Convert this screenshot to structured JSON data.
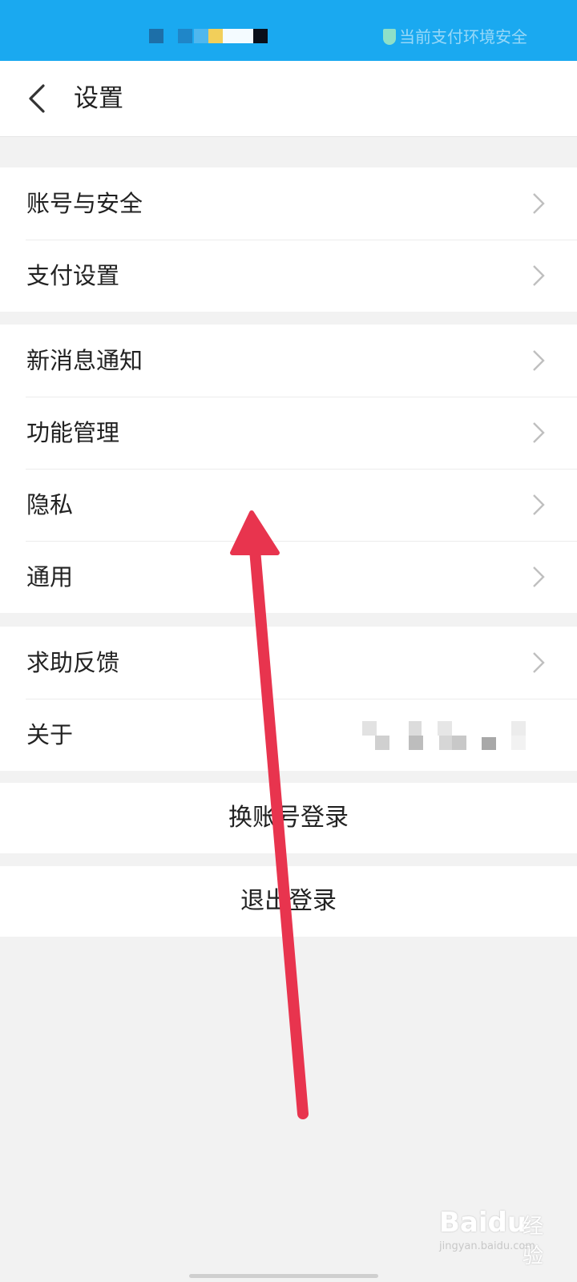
{
  "status_bar": {
    "color": "#1aa9f0",
    "pay_status_text": "当前支付环境安全"
  },
  "header": {
    "title": "设置",
    "back_icon": "chevron-left-icon"
  },
  "groups": [
    {
      "items": [
        {
          "label": "账号与安全"
        },
        {
          "label": "支付设置"
        }
      ]
    },
    {
      "items": [
        {
          "label": "新消息通知"
        },
        {
          "label": "功能管理"
        },
        {
          "label": "隐私"
        },
        {
          "label": "通用"
        }
      ]
    },
    {
      "items": [
        {
          "label": "求助反馈"
        },
        {
          "label": "关于"
        }
      ]
    }
  ],
  "actions": {
    "switch_account": "换账号登录",
    "logout": "退出登录"
  },
  "overlay": {
    "arrow_color": "#e8344e"
  },
  "watermark": {
    "brand": "Baidu",
    "brand2": "经验",
    "url": "jingyan.baidu.com"
  }
}
